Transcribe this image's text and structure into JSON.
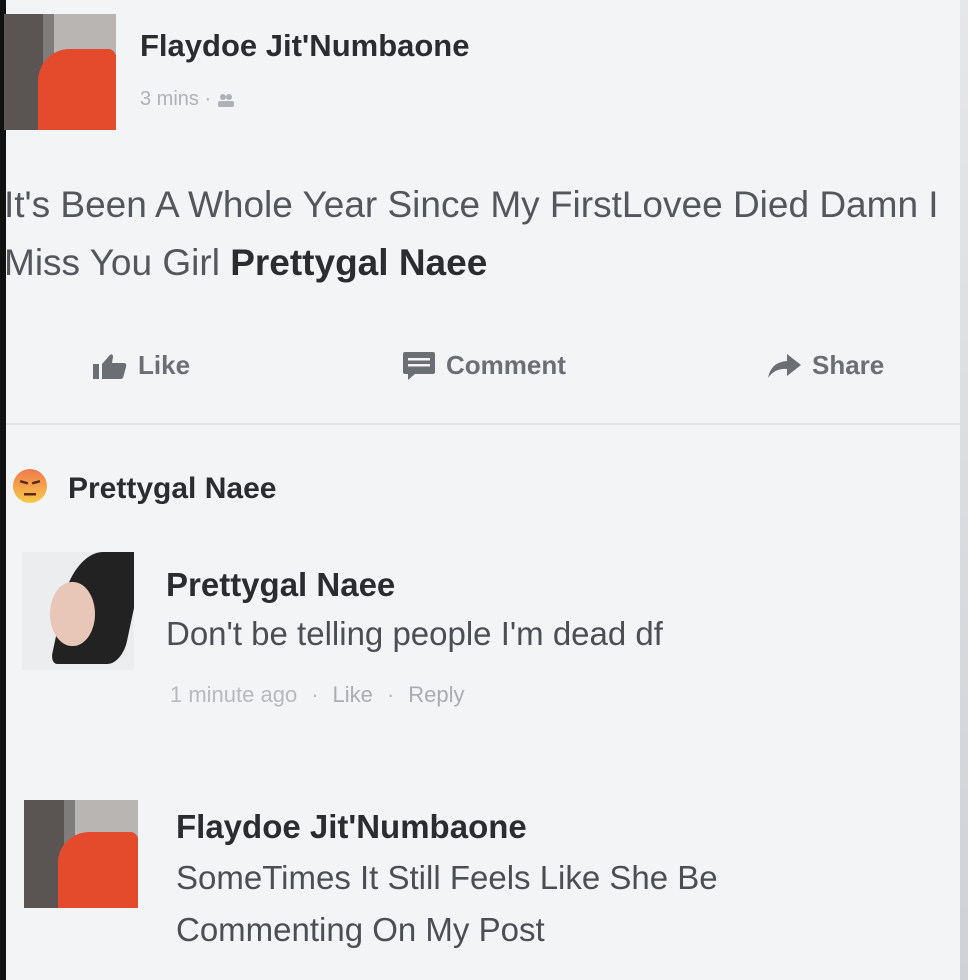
{
  "post": {
    "author": "Flaydoe Jit'Numbaone",
    "time": "3 mins",
    "meta_separator": "·",
    "audience_icon": "friends-icon",
    "text": "It's Been A Whole Year Since My FirstLovee Died Damn I Miss You Girl ",
    "mention": "Prettygal Naee"
  },
  "actions": {
    "like": "Like",
    "comment": "Comment",
    "share": "Share"
  },
  "reaction": {
    "icon": "angry-reaction-icon",
    "name": "Prettygal Naee"
  },
  "comments": [
    {
      "author": "Prettygal Naee",
      "text": "Don't be telling people I'm dead df",
      "time": "1 minute ago",
      "like": "Like",
      "reply": "Reply",
      "separator": "·"
    },
    {
      "author": "Flaydoe Jit'Numbaone",
      "line1": "SomeTimes It Still Feels Like She Be",
      "line2": "Commenting On My Post"
    }
  ],
  "colors": {
    "background": "#f3f4f6",
    "text": "#3a3c40",
    "muted": "#aeb1b6"
  }
}
